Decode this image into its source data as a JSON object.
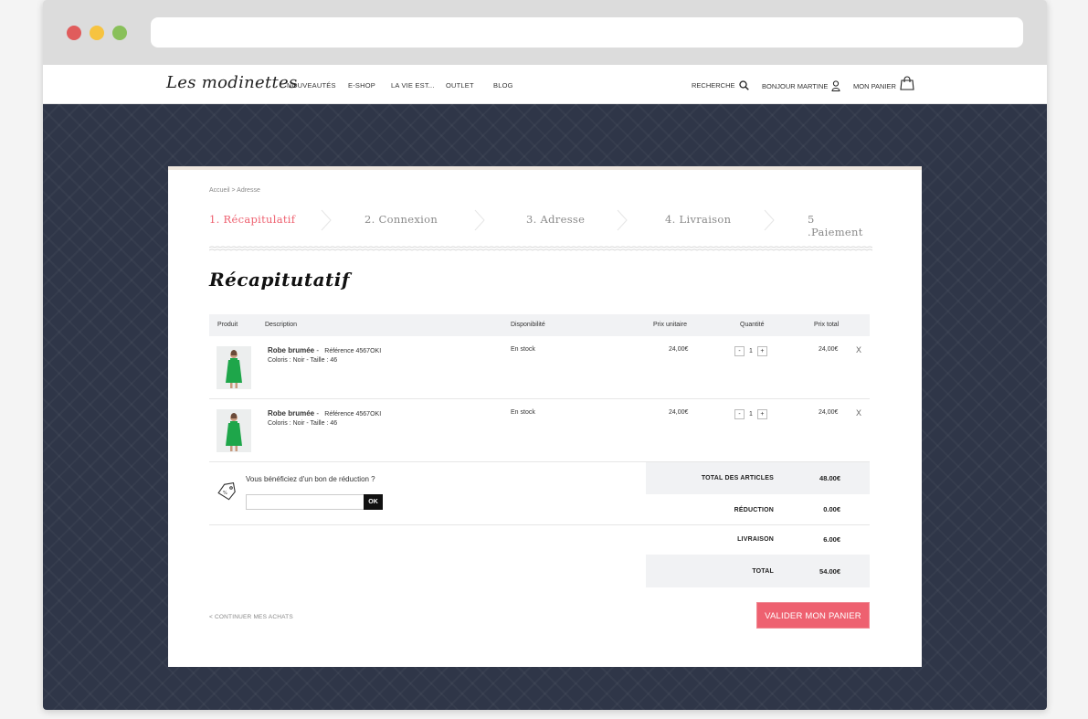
{
  "site": {
    "logo": "Les modinettes"
  },
  "colors": {
    "accent": "#ee6170",
    "background": "#2f3648"
  },
  "nav": {
    "links": [
      "NOUVEAUTÉS",
      "E-SHOP",
      "LA VIE EST...",
      "OUTLET",
      "BLOG"
    ],
    "search_label": "RECHERCHE",
    "account_label": "BONJOUR MARTINE",
    "cart_label": "MON PANIER"
  },
  "breadcrumb": "Accueil > Adresse",
  "steps": [
    "1. Récapitulatif",
    "2. Connexion",
    "3. Adresse",
    "4. Livraison",
    "5 .Paiement"
  ],
  "page_title": "Récapitutatif",
  "table": {
    "headers": [
      "Produit",
      "Description",
      "Disponibilité",
      "Prix unitaire",
      "Quantité",
      "Prix total"
    ],
    "rows": [
      {
        "name": "Robe brumée",
        "sep": "-",
        "ref": "Référence 4567OKI",
        "meta": "Coloris : Noir - Taille : 46",
        "availability": "En stock",
        "unit_price": "24,00€",
        "qty": "1",
        "total": "24,00€",
        "remove": "X",
        "minus": "-",
        "plus": "+"
      },
      {
        "name": "Robe brumée",
        "sep": "-",
        "ref": "Référence 4567OKI",
        "meta": "Coloris : Noir - Taille : 46",
        "availability": "En stock",
        "unit_price": "24,00€",
        "qty": "1",
        "total": "24,00€",
        "remove": "X",
        "minus": "-",
        "plus": "+"
      }
    ]
  },
  "coupon": {
    "question": "Vous bénéficiez d'un bon de réduction ?",
    "value": "",
    "button": "OK"
  },
  "totals": {
    "articles_label": "TOTAL DES ARTICLES",
    "articles_value": "48.00€",
    "reduction_label": "RÉDUCTION",
    "reduction_value": "0.00€",
    "shipping_label": "LIVRAISON",
    "shipping_value": "6.00€",
    "total_label": "TOTAL",
    "total_value": "54.00€"
  },
  "continue_label": "< CONTINUER MES ACHATS",
  "cta_label": "VALIDER MON PANIER"
}
